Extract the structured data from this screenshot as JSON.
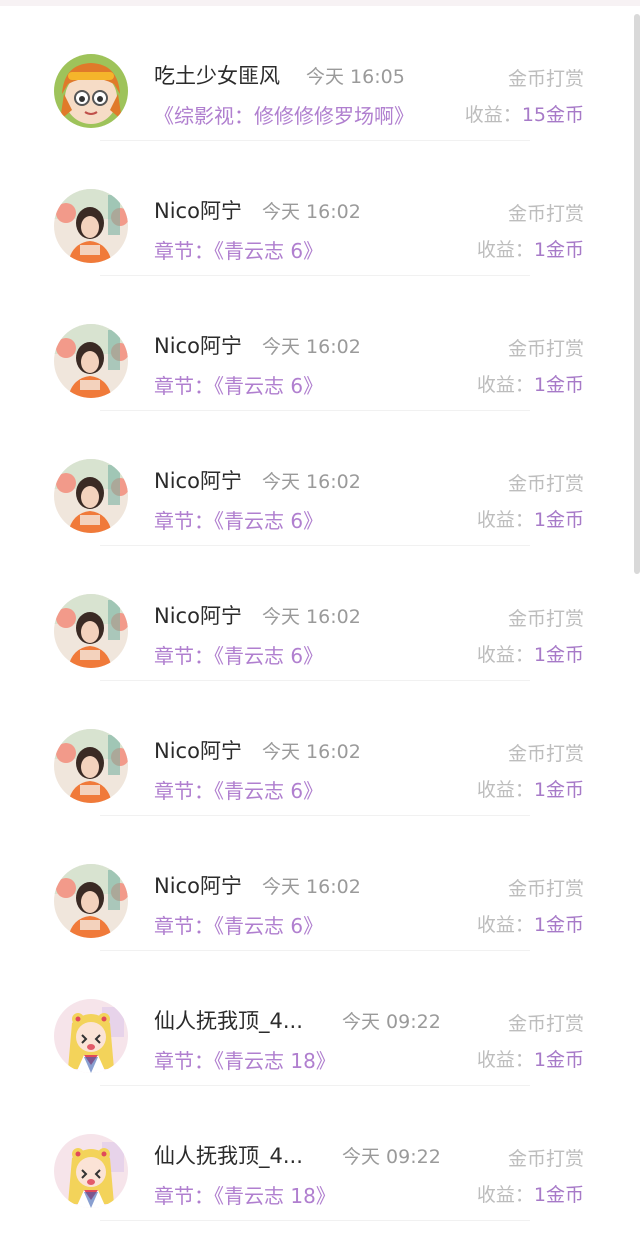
{
  "rows": [
    {
      "name": "吃土少女匪风",
      "time": "今天 16:05",
      "type": "金币打赏",
      "detail_prefix": "",
      "detail_title": "《综影视：修修修修罗场啊》",
      "income_label": "收益：",
      "income_value": "15金币",
      "avatar": "orange-hair-girl"
    },
    {
      "name": "Nico阿宁",
      "time": "今天 16:02",
      "type": "金币打赏",
      "detail_prefix": "章节：",
      "detail_title": "《青云志 6》",
      "income_label": "收益：",
      "income_value": "1金币",
      "avatar": "girl-photo"
    },
    {
      "name": "Nico阿宁",
      "time": "今天 16:02",
      "type": "金币打赏",
      "detail_prefix": "章节：",
      "detail_title": "《青云志 6》",
      "income_label": "收益：",
      "income_value": "1金币",
      "avatar": "girl-photo"
    },
    {
      "name": "Nico阿宁",
      "time": "今天 16:02",
      "type": "金币打赏",
      "detail_prefix": "章节：",
      "detail_title": "《青云志 6》",
      "income_label": "收益：",
      "income_value": "1金币",
      "avatar": "girl-photo"
    },
    {
      "name": "Nico阿宁",
      "time": "今天 16:02",
      "type": "金币打赏",
      "detail_prefix": "章节：",
      "detail_title": "《青云志 6》",
      "income_label": "收益：",
      "income_value": "1金币",
      "avatar": "girl-photo"
    },
    {
      "name": "Nico阿宁",
      "time": "今天 16:02",
      "type": "金币打赏",
      "detail_prefix": "章节：",
      "detail_title": "《青云志 6》",
      "income_label": "收益：",
      "income_value": "1金币",
      "avatar": "girl-photo"
    },
    {
      "name": "Nico阿宁",
      "time": "今天 16:02",
      "type": "金币打赏",
      "detail_prefix": "章节：",
      "detail_title": "《青云志 6》",
      "income_label": "收益：",
      "income_value": "1金币",
      "avatar": "girl-photo"
    },
    {
      "name": "仙人抚我顶_4...",
      "time": "今天 09:22",
      "type": "金币打赏",
      "detail_prefix": "章节：",
      "detail_title": "《青云志 18》",
      "income_label": "收益：",
      "income_value": "1金币",
      "avatar": "sailor-anime-girl"
    },
    {
      "name": "仙人抚我顶_4...",
      "time": "今天 09:22",
      "type": "金币打赏",
      "detail_prefix": "章节：",
      "detail_title": "《青云志 18》",
      "income_label": "收益：",
      "income_value": "1金币",
      "avatar": "sailor-anime-girl"
    }
  ],
  "colors": {
    "accent": "#b07fcf",
    "name": "#2b2b2b",
    "muted": "#bdbdbd",
    "time": "#9a9a9a"
  }
}
